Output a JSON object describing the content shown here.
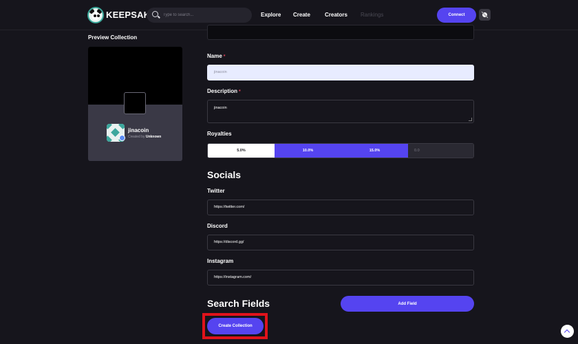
{
  "header": {
    "logo_text": "KEEPSAKE",
    "search_placeholder": "Type to search...",
    "nav": [
      "Explore",
      "Create",
      "Creators",
      "Rankings"
    ],
    "connect_label": "Connect"
  },
  "preview": {
    "title": "Preview Collection",
    "collection_name": "jinacoin",
    "created_by_prefix": "Created by",
    "created_by_name": "Unknown"
  },
  "form": {
    "name_label": "Name",
    "required_mark": "*",
    "name_value": "jinacoin",
    "description_label": "Description",
    "description_value": "jinacoin",
    "royalties_label": "Royalties",
    "royalty_options": [
      "5.0%",
      "10.0%",
      "15.0%"
    ],
    "royalty_custom_placeholder": "0.0",
    "socials_title": "Socials",
    "twitter_label": "Twitter",
    "twitter_value": "https://twitter.com/",
    "discord_label": "Discord",
    "discord_value": "https://discord.gg/",
    "instagram_label": "Instagram",
    "instagram_value": "https://instagram.com/",
    "search_fields_title": "Search Fields",
    "add_field_label": "Add Field",
    "create_label": "Create Collection"
  },
  "colors": {
    "accent": "#5544f0",
    "background": "#16151c",
    "highlight_box": "#e0131b"
  }
}
